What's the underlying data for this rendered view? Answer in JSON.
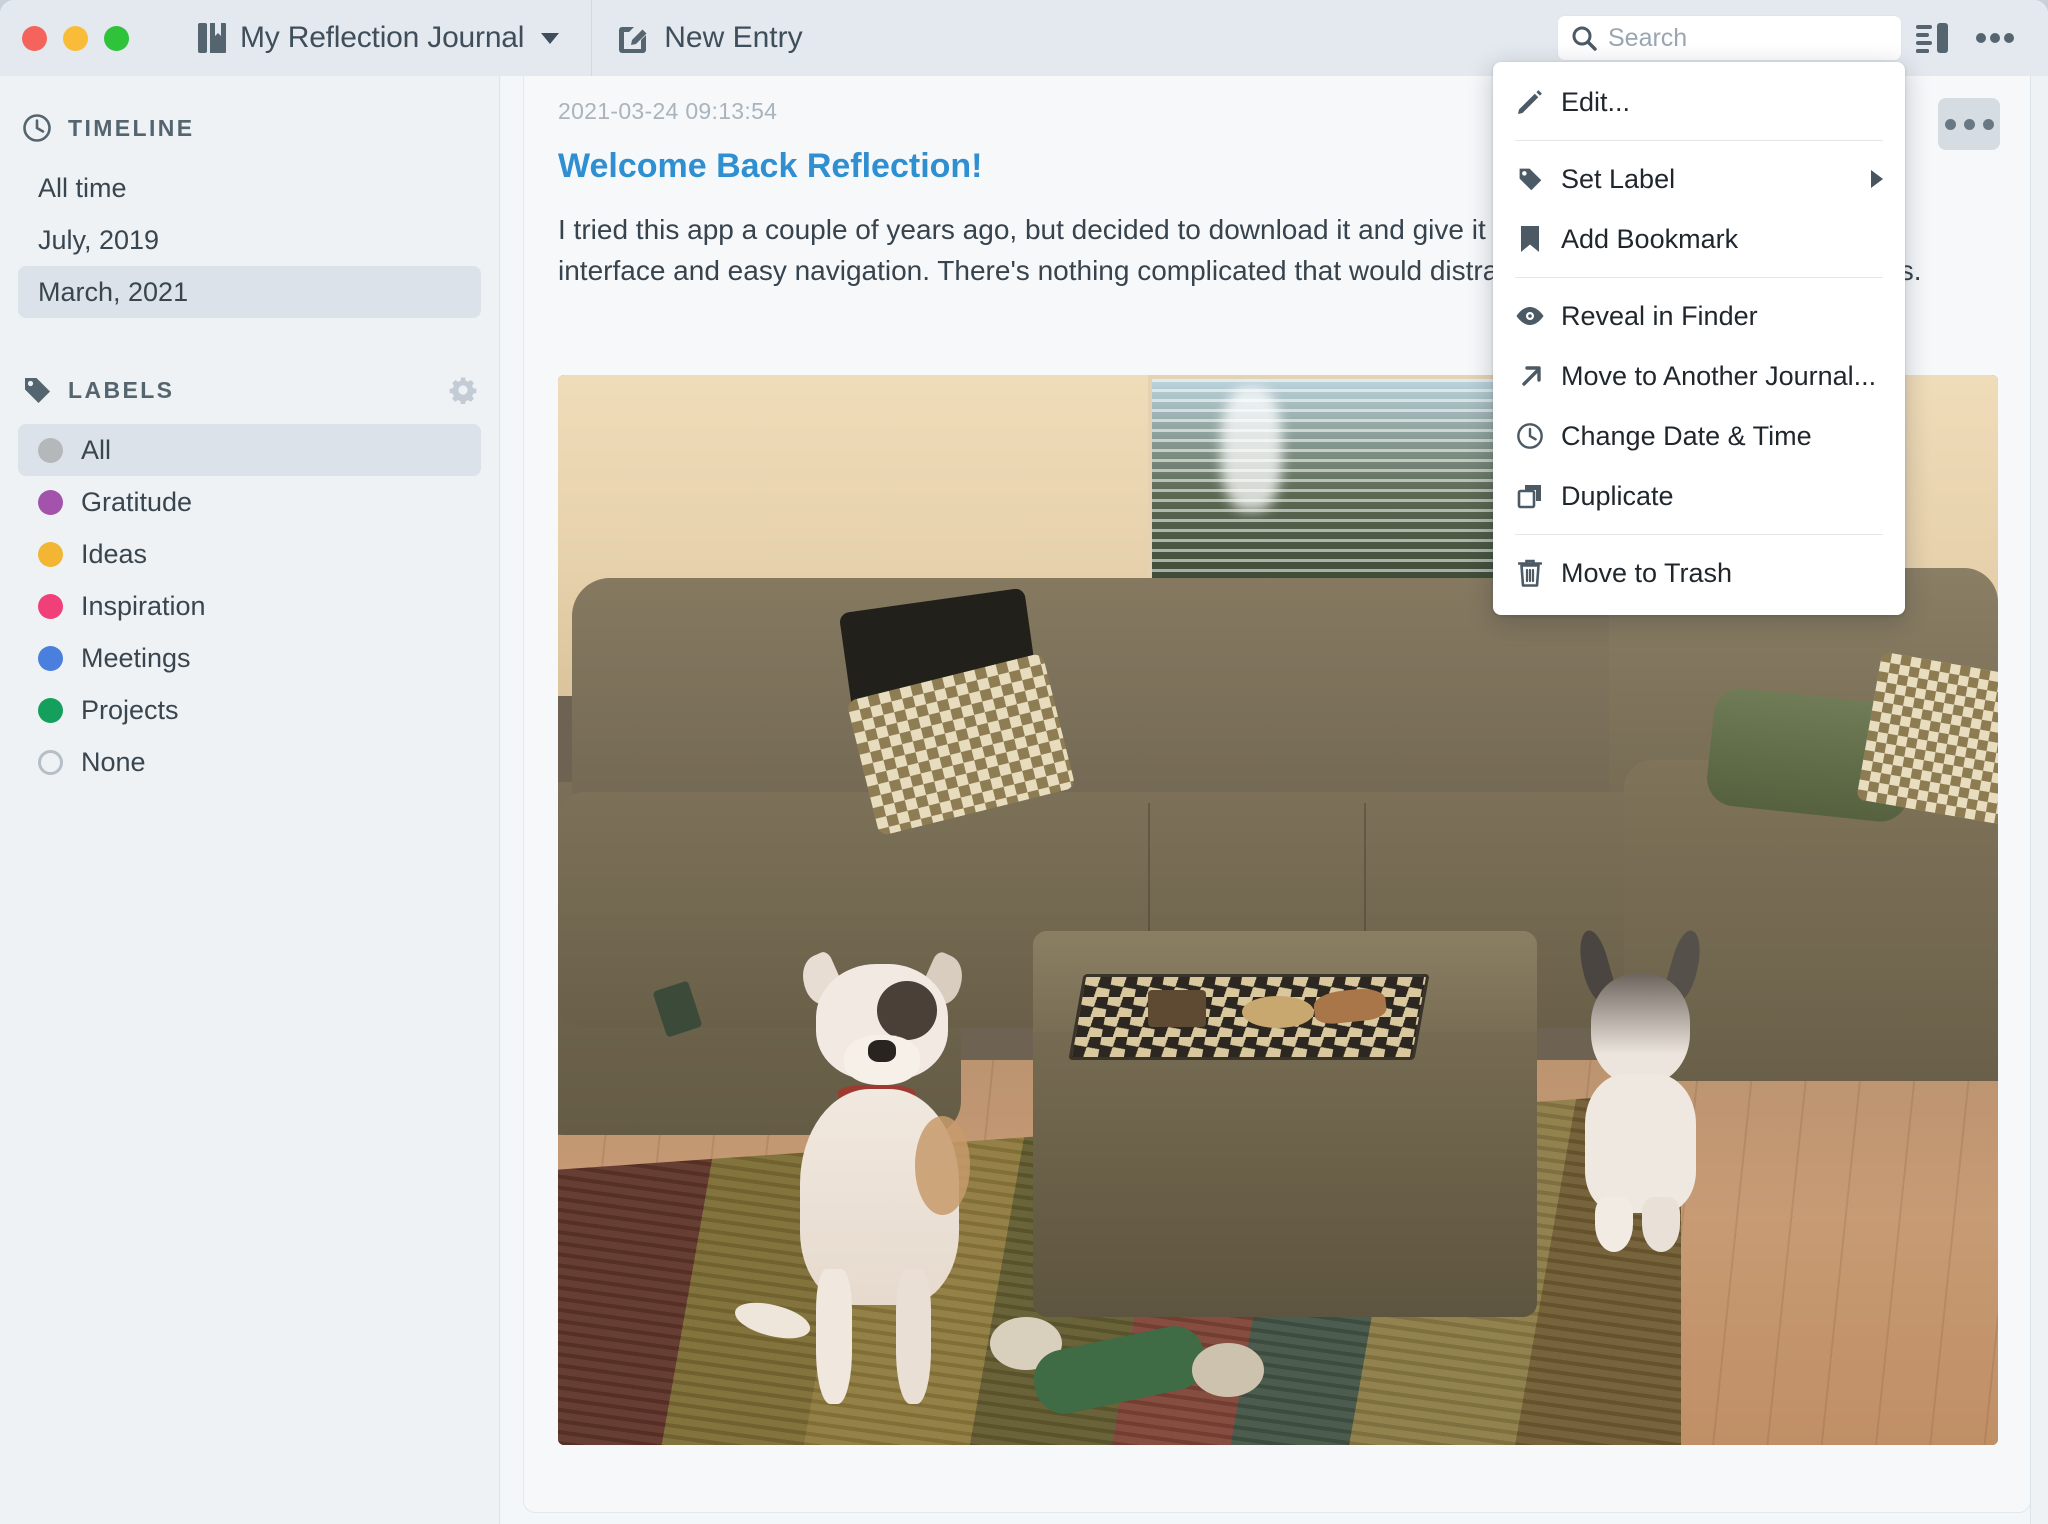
{
  "toolbar": {
    "journal_name": "My Reflection Journal",
    "journal_icon": "book-icon",
    "journal_caret": "chevron-down-icon",
    "new_entry_label": "New Entry",
    "new_entry_icon": "compose-icon",
    "search": {
      "placeholder": "Search",
      "value": "",
      "icon": "search-icon"
    },
    "layout_toggle_icon": "layout-panel-icon",
    "more_icon": "ellipsis-icon"
  },
  "sidebar": {
    "timeline": {
      "heading": "TIMELINE",
      "icon": "clock-icon",
      "items": [
        {
          "label": "All time",
          "selected": false
        },
        {
          "label": "July, 2019",
          "selected": false
        },
        {
          "label": "March, 2021",
          "selected": true
        }
      ]
    },
    "labels": {
      "heading": "LABELS",
      "icon": "tag-icon",
      "settings_icon": "gear-icon",
      "items": [
        {
          "label": "All",
          "color": "#b4b8bb",
          "selected": true
        },
        {
          "label": "Gratitude",
          "color": "#a353ab",
          "selected": false
        },
        {
          "label": "Ideas",
          "color": "#f2b632",
          "selected": false
        },
        {
          "label": "Inspiration",
          "color": "#f03f79",
          "selected": false
        },
        {
          "label": "Meetings",
          "color": "#4a7fe0",
          "selected": false
        },
        {
          "label": "Projects",
          "color": "#14a05c",
          "selected": false
        },
        {
          "label": "None",
          "color": "transparent",
          "selected": false
        }
      ]
    }
  },
  "entry": {
    "date": "2021-03-24 09:13:54",
    "title": "Welcome Back Reflection!",
    "body": "I tried this app a couple of years ago, but decided to download it and give it another try. I like the minimalistic interface and easy navigation. There's nothing complicated that would distract me from capturing my thoughts.",
    "more_icon": "ellipsis-icon",
    "photo_alt": "Two dogs in a living room with a brown sectional couch, ottoman with a patterned tray, and a multicolored area rug"
  },
  "context_menu": {
    "groups": [
      [
        {
          "label": "Edit...",
          "icon": "pencil-icon",
          "submenu": false
        }
      ],
      [
        {
          "label": "Set Label",
          "icon": "tag-icon",
          "submenu": true
        },
        {
          "label": "Add Bookmark",
          "icon": "bookmark-icon",
          "submenu": false
        }
      ],
      [
        {
          "label": "Reveal in Finder",
          "icon": "eye-icon",
          "submenu": false
        },
        {
          "label": "Move to Another Journal...",
          "icon": "arrow-up-right-icon",
          "submenu": false
        },
        {
          "label": "Change Date & Time",
          "icon": "clock-icon",
          "submenu": false
        },
        {
          "label": "Duplicate",
          "icon": "duplicate-icon",
          "submenu": false
        }
      ],
      [
        {
          "label": "Move to Trash",
          "icon": "trash-icon",
          "submenu": false
        }
      ]
    ]
  },
  "window_controls": {
    "close": "#f4645c",
    "minimize": "#f8bc39",
    "zoom": "#2fc33c"
  },
  "colors": {
    "accent_title": "#2f8fd0",
    "toolbar_bg": "#e3e9ee",
    "sidebar_bg": "#eef2f5",
    "selected_row": "#dbe2e9"
  }
}
